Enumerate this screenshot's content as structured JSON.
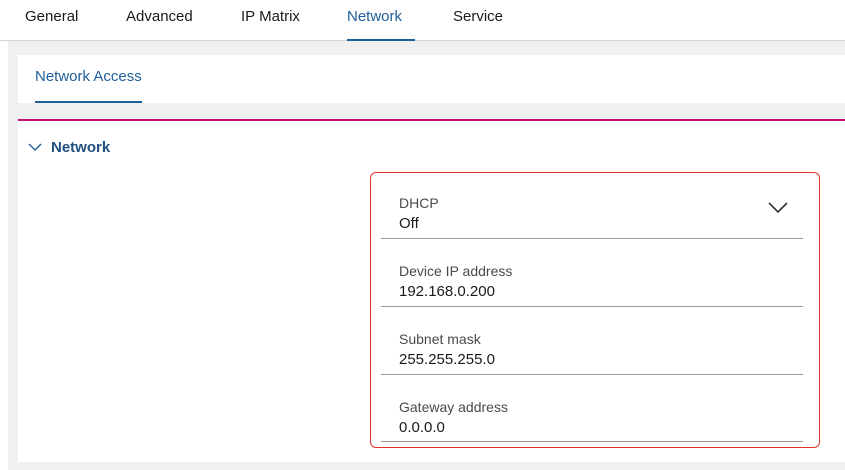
{
  "top_tabs": [
    {
      "label": "General"
    },
    {
      "label": "Advanced"
    },
    {
      "label": "IP Matrix"
    },
    {
      "label": "Network"
    },
    {
      "label": "Service"
    }
  ],
  "active_top_tab": "Network",
  "sub_tabs": [
    {
      "label": "Network Access"
    }
  ],
  "section": {
    "title": "Network",
    "expanded": true
  },
  "fields": {
    "dhcp": {
      "label": "DHCP",
      "value": "Off"
    },
    "device_ip": {
      "label": "Device IP address",
      "value": "192.168.0.200"
    },
    "subnet_mask": {
      "label": "Subnet mask",
      "value": "255.255.255.0"
    },
    "gateway": {
      "label": "Gateway address",
      "value": "0.0.0.0"
    }
  },
  "icons": {
    "section_toggle": "chevron-down-icon",
    "dhcp_dropdown": "chevron-down-icon"
  },
  "colors": {
    "accent_blue": "#1f5f9a",
    "section_title": "#1f4f80",
    "magenta_rule": "#c3127a",
    "highlight_border": "#e0332e",
    "background_gray": "#f0f0f0"
  }
}
